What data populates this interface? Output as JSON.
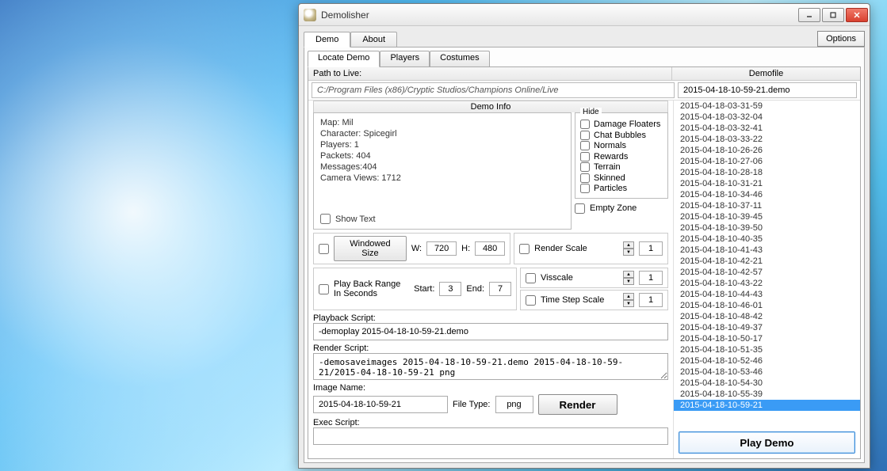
{
  "window": {
    "title": "Demolisher"
  },
  "tabs": {
    "demo": "Demo",
    "about": "About",
    "options": "Options"
  },
  "subtabs": {
    "locate": "Locate Demo",
    "players": "Players",
    "costumes": "Costumes"
  },
  "headers": {
    "path": "Path to Live:",
    "demofile": "Demofile",
    "demo_info": "Demo Info"
  },
  "path_value": "C:/Program Files (x86)/Cryptic Studios/Champions Online/Live",
  "demofile_value": "2015-04-18-10-59-21.demo",
  "demo_info": {
    "map": "Map: Mil",
    "character": "Character: Spicegirl",
    "players": "Players: 1",
    "packets": "Packets: 404",
    "messages": "Messages:404",
    "camera": "Camera Views: 1712",
    "show_text": "Show Text"
  },
  "hide": {
    "legend": "Hide",
    "items": [
      "Damage Floaters",
      "Chat Bubbles",
      "Normals",
      "Rewards",
      "Terrain",
      "Skinned",
      "Particles"
    ],
    "empty_zone": "Empty Zone"
  },
  "size": {
    "windowed_btn": "Windowed Size",
    "w_label": "W:",
    "w_value": "720",
    "h_label": "H:",
    "h_value": "480"
  },
  "scale": {
    "render": "Render Scale",
    "render_val": "1",
    "visc": "Visscale",
    "visc_val": "1",
    "timestep": "Time Step Scale",
    "timestep_val": "1"
  },
  "playback": {
    "checkbox_label": "Play Back Range In Seconds",
    "start_label": "Start:",
    "start_val": "3",
    "end_label": "End:",
    "end_val": "7"
  },
  "scripts": {
    "playback_label": "Playback Script:",
    "playback_val": "-demoplay 2015-04-18-10-59-21.demo",
    "render_label": "Render Script:",
    "render_val": "-demosaveimages 2015-04-18-10-59-21.demo 2015-04-18-10-59-21/2015-04-18-10-59-21 png",
    "image_name_label": "Image Name:",
    "image_name_val": "2015-04-18-10-59-21",
    "file_type_label": "File Type:",
    "file_type_val": "png",
    "render_btn": "Render",
    "exec_label": "Exec Script:",
    "exec_val": ""
  },
  "play_btn": "Play Demo",
  "files": [
    "2015-04-18-03-31-59",
    "2015-04-18-03-32-04",
    "2015-04-18-03-32-41",
    "2015-04-18-03-33-22",
    "2015-04-18-10-26-26",
    "2015-04-18-10-27-06",
    "2015-04-18-10-28-18",
    "2015-04-18-10-31-21",
    "2015-04-18-10-34-46",
    "2015-04-18-10-37-11",
    "2015-04-18-10-39-45",
    "2015-04-18-10-39-50",
    "2015-04-18-10-40-35",
    "2015-04-18-10-41-43",
    "2015-04-18-10-42-21",
    "2015-04-18-10-42-57",
    "2015-04-18-10-43-22",
    "2015-04-18-10-44-43",
    "2015-04-18-10-46-01",
    "2015-04-18-10-48-42",
    "2015-04-18-10-49-37",
    "2015-04-18-10-50-17",
    "2015-04-18-10-51-35",
    "2015-04-18-10-52-46",
    "2015-04-18-10-53-46",
    "2015-04-18-10-54-30",
    "2015-04-18-10-55-39",
    "2015-04-18-10-59-21"
  ],
  "selected_file_index": 27
}
